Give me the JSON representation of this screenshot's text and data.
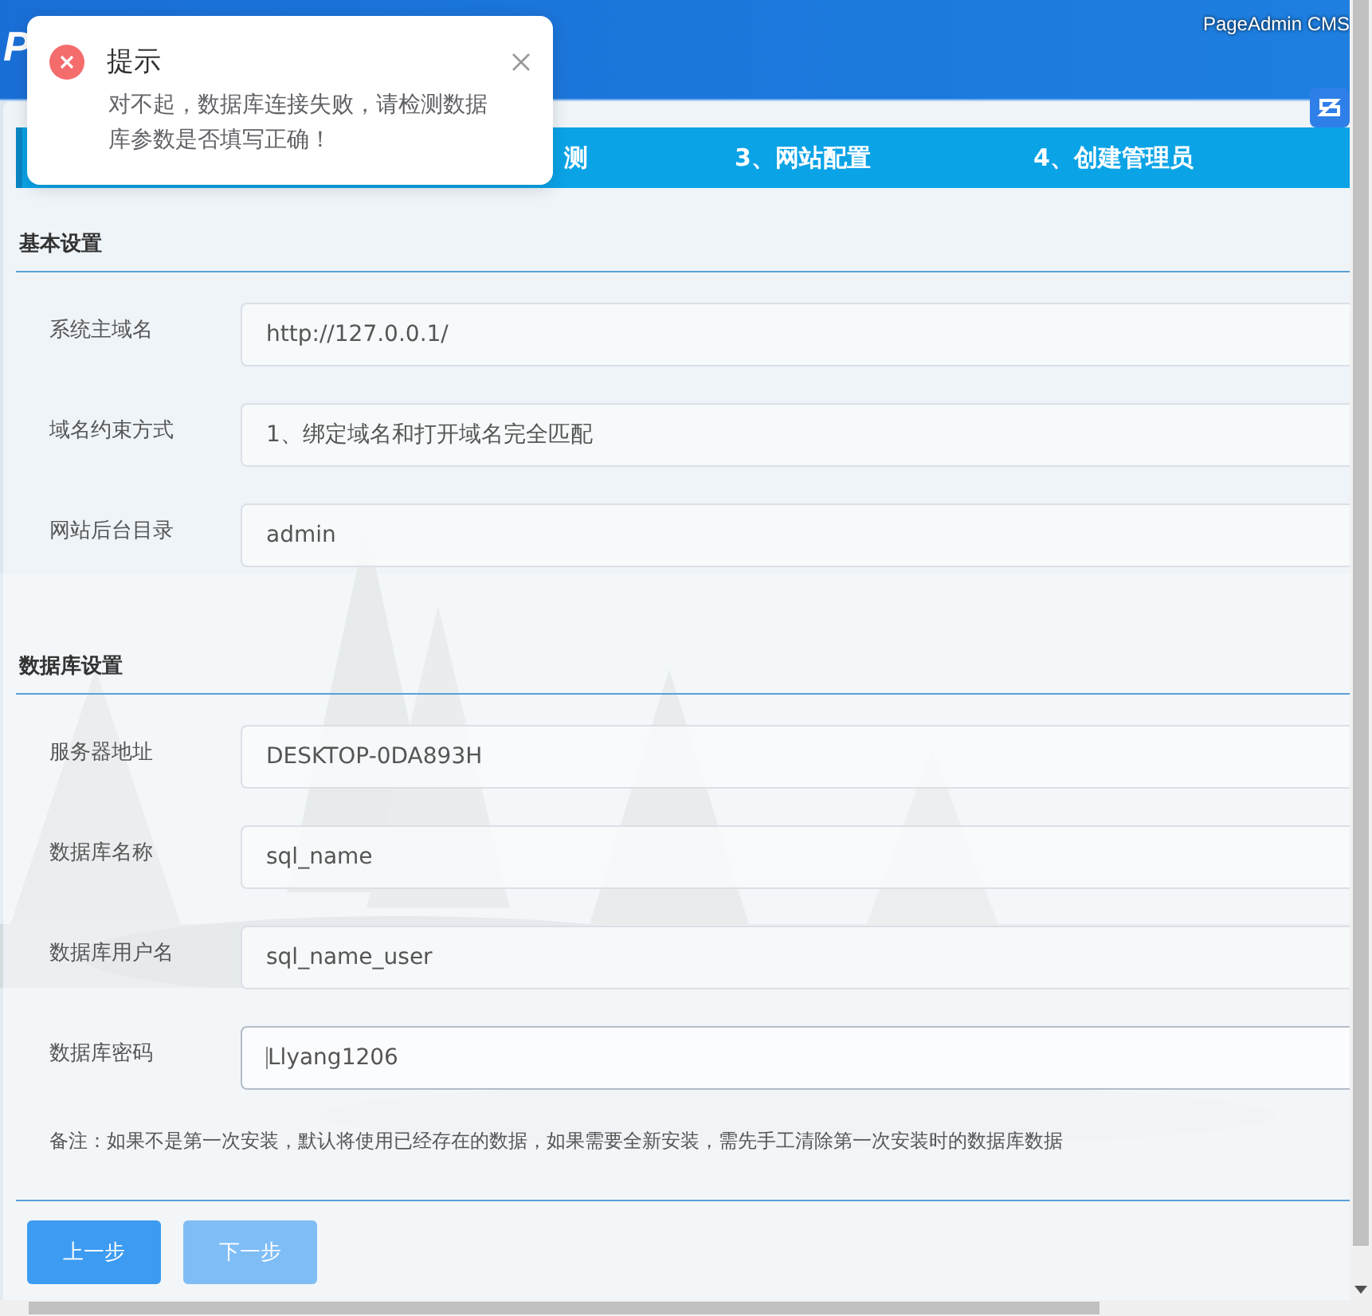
{
  "header": {
    "logo": "P",
    "product": "PageAdmin CMS"
  },
  "steps": [
    {
      "label": "测",
      "selected": false
    },
    {
      "label": "3、网站配置",
      "selected": false
    },
    {
      "label": "4、创建管理员",
      "selected": false
    }
  ],
  "sections": [
    {
      "title": "基本设置",
      "fields": [
        {
          "label": "系统主域名",
          "value": "http://127.0.0.1/",
          "focused": false
        },
        {
          "label": "域名约束方式",
          "value": "1、绑定域名和打开域名完全匹配",
          "focused": false
        },
        {
          "label": "网站后台目录",
          "value": "admin",
          "focused": false
        }
      ]
    },
    {
      "title": "数据库设置",
      "fields": [
        {
          "label": "服务器地址",
          "value": "DESKTOP-0DA893H",
          "focused": false
        },
        {
          "label": "数据库名称",
          "value": "sql_name",
          "focused": false
        },
        {
          "label": "数据库用户名",
          "value": "sql_name_user",
          "focused": false
        },
        {
          "label": "数据库密码",
          "value": "Llyang1206",
          "focused": true
        }
      ]
    }
  ],
  "note": "备注：如果不是第一次安装，默认将使用已经存在的数据，如果需要全新安装，需先手工清除第一次安装时的数据库数据",
  "buttons": [
    {
      "label": "上一步",
      "disabled": false
    },
    {
      "label": "下一步",
      "disabled": true
    }
  ],
  "toast": {
    "title": "提示",
    "message": "对不起，数据库连接失败，请检测数据库参数是否填写正确！"
  }
}
